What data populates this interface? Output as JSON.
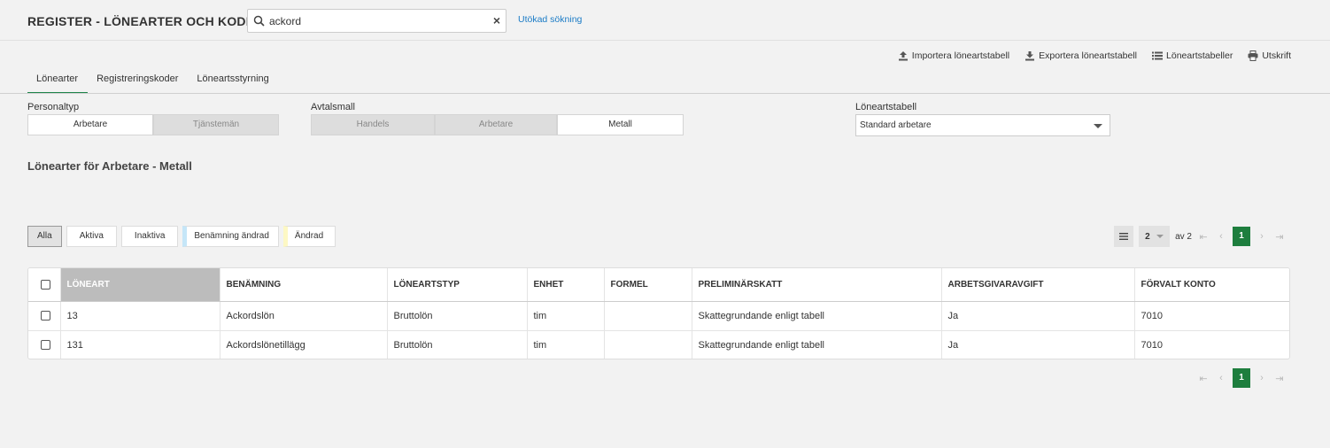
{
  "header": {
    "title": "REGISTER - LÖNEARTER OCH KODER",
    "search_value": "ackord",
    "extended_search": "Utökad sökning"
  },
  "toolbar": {
    "import": "Importera löneartstabell",
    "export": "Exportera löneartstabell",
    "tables": "Löneartstabeller",
    "print": "Utskrift"
  },
  "tabs": [
    "Lönearter",
    "Registreringskoder",
    "Löneartsstyrning"
  ],
  "personaltyp": {
    "label": "Personaltyp",
    "options": [
      "Arbetare",
      "Tjänstemän"
    ],
    "selected": "Arbetare"
  },
  "avtalsmall": {
    "label": "Avtalsmall",
    "options": [
      "Handels",
      "Arbetare",
      "Metall"
    ],
    "selected": "Metall"
  },
  "loneartstabell": {
    "label": "Löneartstabell",
    "value": "Standard arbetare"
  },
  "section_title": "Lönearter för Arbetare - Metall",
  "filters": [
    "Alla",
    "Aktiva",
    "Inaktiva",
    "Benämning ändrad",
    "Ändrad"
  ],
  "pager": {
    "page_size": "2",
    "of_text": "av 2",
    "current_page": "1"
  },
  "table": {
    "columns": [
      "LÖNEART",
      "BENÄMNING",
      "LÖNEARTSTYP",
      "ENHET",
      "FORMEL",
      "PRELIMINÄRSKATT",
      "ARBETSGIVARAVGIFT",
      "FÖRVALT KONTO"
    ],
    "rows": [
      [
        "13",
        "Ackordslön",
        "Bruttolön",
        "tim",
        "",
        "Skattegrundande enligt tabell",
        "Ja",
        "7010"
      ],
      [
        "131",
        "Ackordslönetillägg",
        "Bruttolön",
        "tim",
        "",
        "Skattegrundande enligt tabell",
        "Ja",
        "7010"
      ]
    ]
  },
  "colors": {
    "accent_green": "#1e7e3e",
    "link_blue": "#1a7bc6"
  }
}
